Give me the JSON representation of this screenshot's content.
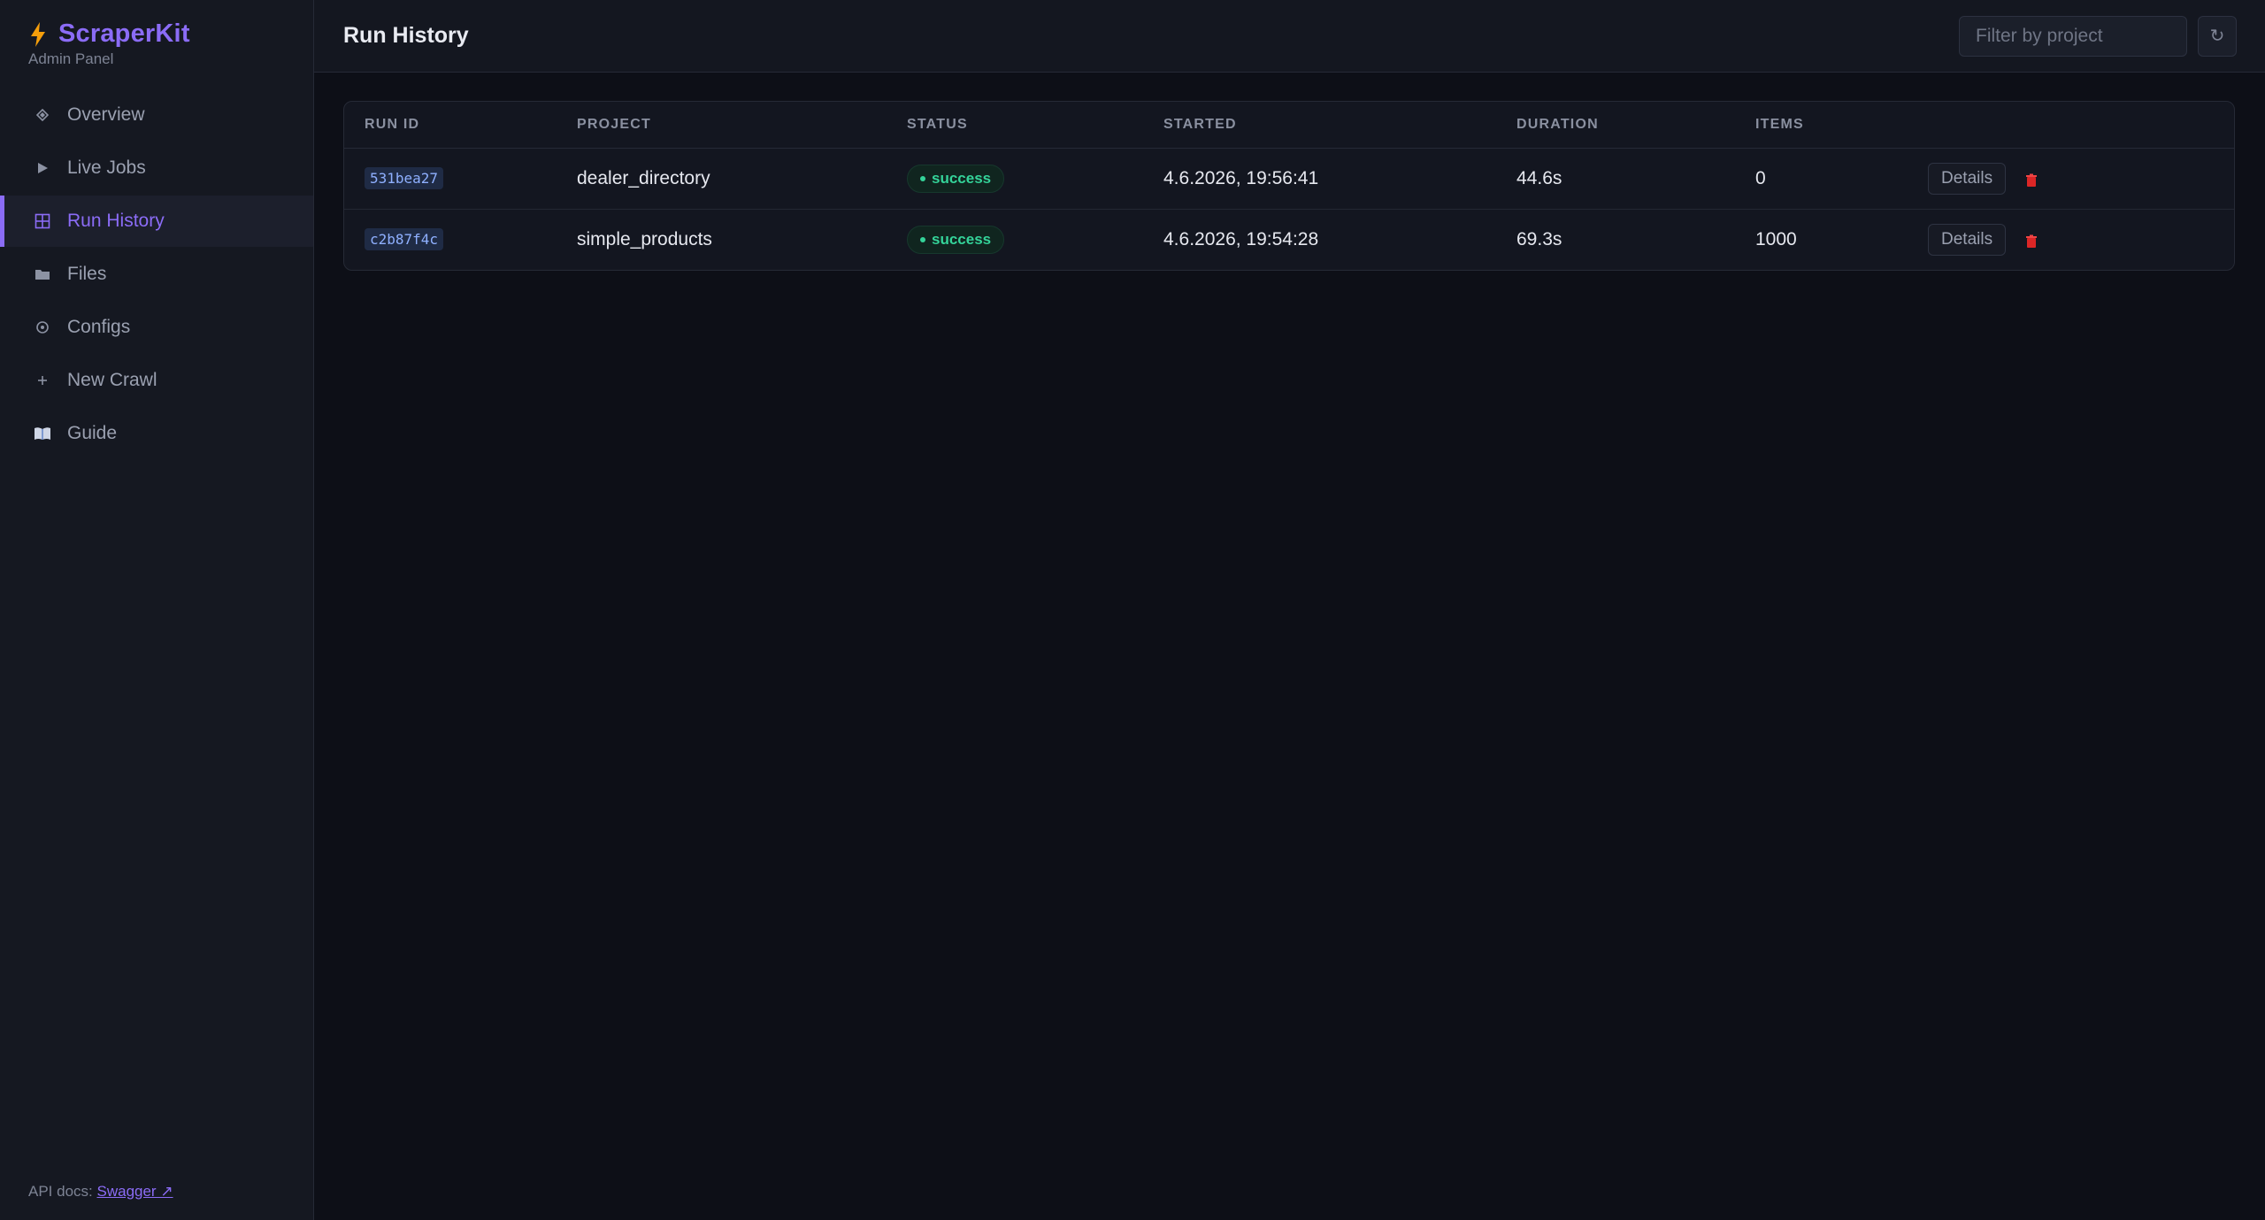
{
  "brand": {
    "name": "ScraperKit",
    "subtitle": "Admin Panel"
  },
  "sidebar": {
    "items": [
      {
        "label": "Overview",
        "icon": "diamond-icon"
      },
      {
        "label": "Live Jobs",
        "icon": "play-icon"
      },
      {
        "label": "Run History",
        "icon": "grid-icon",
        "active": true
      },
      {
        "label": "Files",
        "icon": "folder-icon"
      },
      {
        "label": "Configs",
        "icon": "gear-icon"
      },
      {
        "label": "New Crawl",
        "icon": "plus-icon"
      },
      {
        "label": "Guide",
        "icon": "book-icon"
      }
    ],
    "footer": {
      "prefix": "API docs:",
      "link_label": "Swagger ↗"
    }
  },
  "header": {
    "title": "Run History",
    "filter_placeholder": "Filter by project",
    "refresh_label": "↻"
  },
  "table": {
    "columns": [
      "RUN ID",
      "PROJECT",
      "STATUS",
      "STARTED",
      "DURATION",
      "ITEMS"
    ],
    "rows": [
      {
        "run_id": "531bea27",
        "project": "dealer_directory",
        "status": "success",
        "started": "4.6.2026, 19:56:41",
        "duration": "44.6s",
        "items": "0",
        "details_label": "Details"
      },
      {
        "run_id": "c2b87f4c",
        "project": "simple_products",
        "status": "success",
        "started": "4.6.2026, 19:54:28",
        "duration": "69.3s",
        "items": "1000",
        "details_label": "Details"
      }
    ]
  },
  "colors": {
    "accent": "#8b6cf6",
    "success": "#34d399",
    "danger": "#ef4444",
    "brand_bolt": "#f59e0b"
  }
}
